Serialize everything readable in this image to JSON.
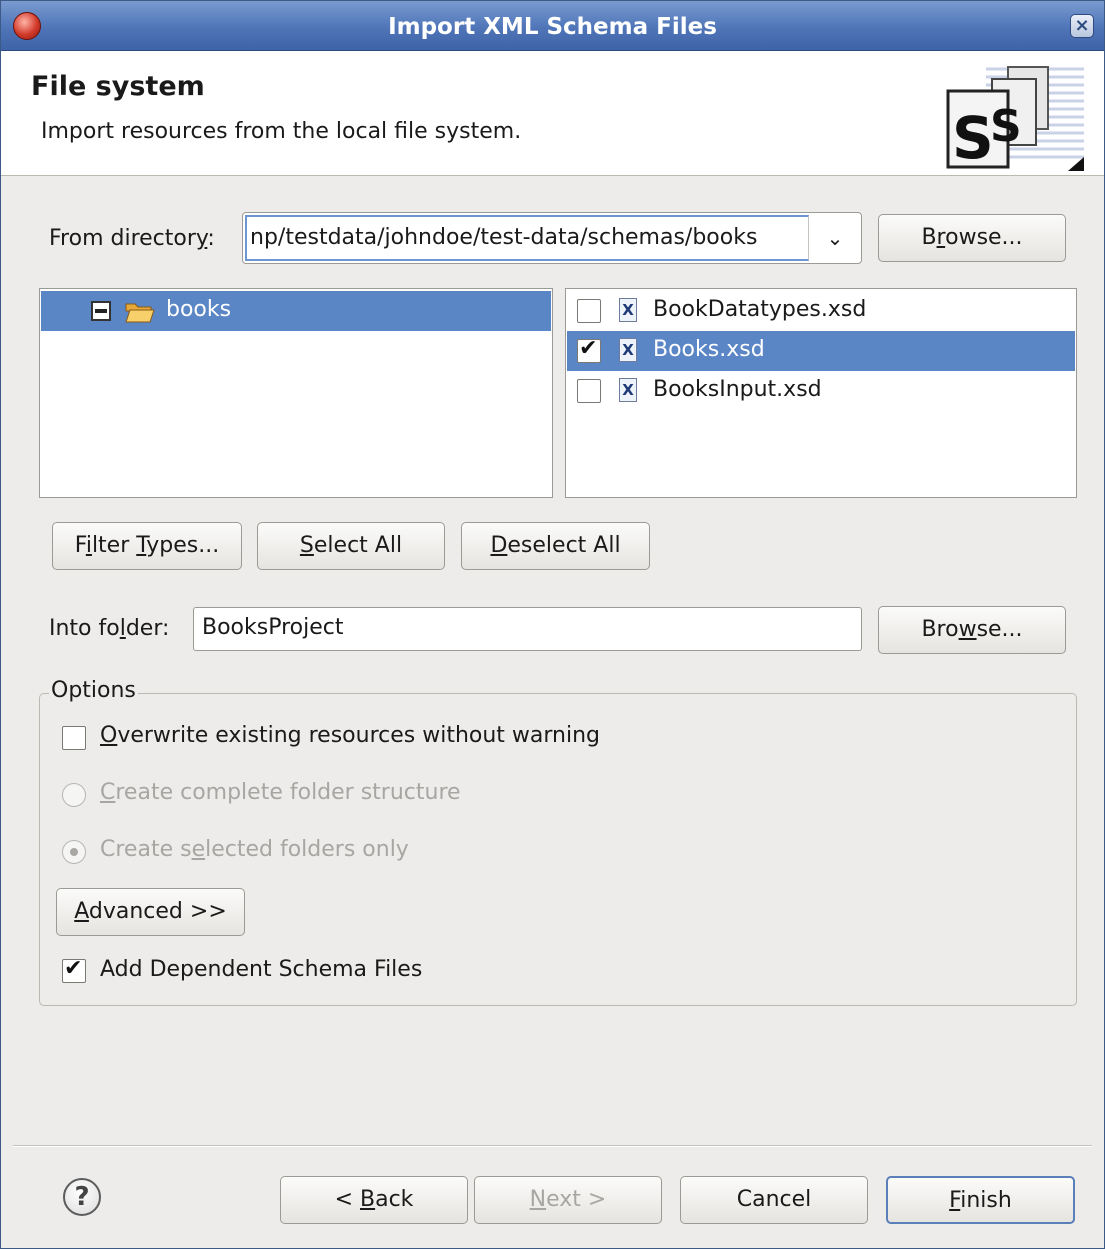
{
  "window": {
    "title": "Import XML Schema Files"
  },
  "banner": {
    "heading": "File system",
    "description": "Import resources from the local file system."
  },
  "from_directory": {
    "label_pre": "From director",
    "label_mn": "y",
    "label_post": ":",
    "value": "np/testdata/johndoe/test-data/schemas/books",
    "browse_pre": "B",
    "browse_mn": "r",
    "browse_post": "owse..."
  },
  "tree": {
    "folder_label": "books",
    "folder_icon": "folder-open-icon",
    "toggle_icon": "collapse-icon"
  },
  "files": [
    {
      "name": "BookDatatypes.xsd",
      "checked": false,
      "selected": false,
      "icon": "xsd-file-icon",
      "icon_glyph": "X"
    },
    {
      "name": "Books.xsd",
      "checked": true,
      "selected": true,
      "icon": "xsd-file-icon",
      "icon_glyph": "X"
    },
    {
      "name": "BooksInput.xsd",
      "checked": false,
      "selected": false,
      "icon": "xsd-file-icon",
      "icon_glyph": "X"
    }
  ],
  "selection_buttons": {
    "filter_pre": "F",
    "filter_mn": "i",
    "filter_mid": "lter ",
    "filter_mn2": "T",
    "filter_post": "ypes...",
    "select_mn": "S",
    "select_post": "elect All",
    "deselect_mn": "D",
    "deselect_post": "eselect All"
  },
  "into_folder": {
    "label_pre": "Into fo",
    "label_mn": "l",
    "label_post": "der:",
    "value": "BooksProject",
    "browse_pre": "Bro",
    "browse_mn": "w",
    "browse_post": "se..."
  },
  "options": {
    "title": "Options",
    "overwrite_mn": "O",
    "overwrite_post": "verwrite existing resources without warning",
    "overwrite_checked": false,
    "complete_mn": "C",
    "complete_post": "reate complete folder structure",
    "complete_selected": false,
    "selected_pre": "Create s",
    "selected_mn": "e",
    "selected_post": "lected folders only",
    "selected_selected": true,
    "advanced_mn": "A",
    "advanced_post": "dvanced >>",
    "dependent_label": "Add Dependent Schema Files",
    "dependent_checked": true
  },
  "footer": {
    "help_glyph": "?",
    "back_pre": "< ",
    "back_mn": "B",
    "back_post": "ack",
    "next_mn": "N",
    "next_post": "ext >",
    "cancel": "Cancel",
    "finish_mn": "F",
    "finish_post": "inish"
  },
  "colors": {
    "selection": "#5b86c6",
    "title_bar": "#4f75b8",
    "dialog_bg": "#edeceb"
  }
}
